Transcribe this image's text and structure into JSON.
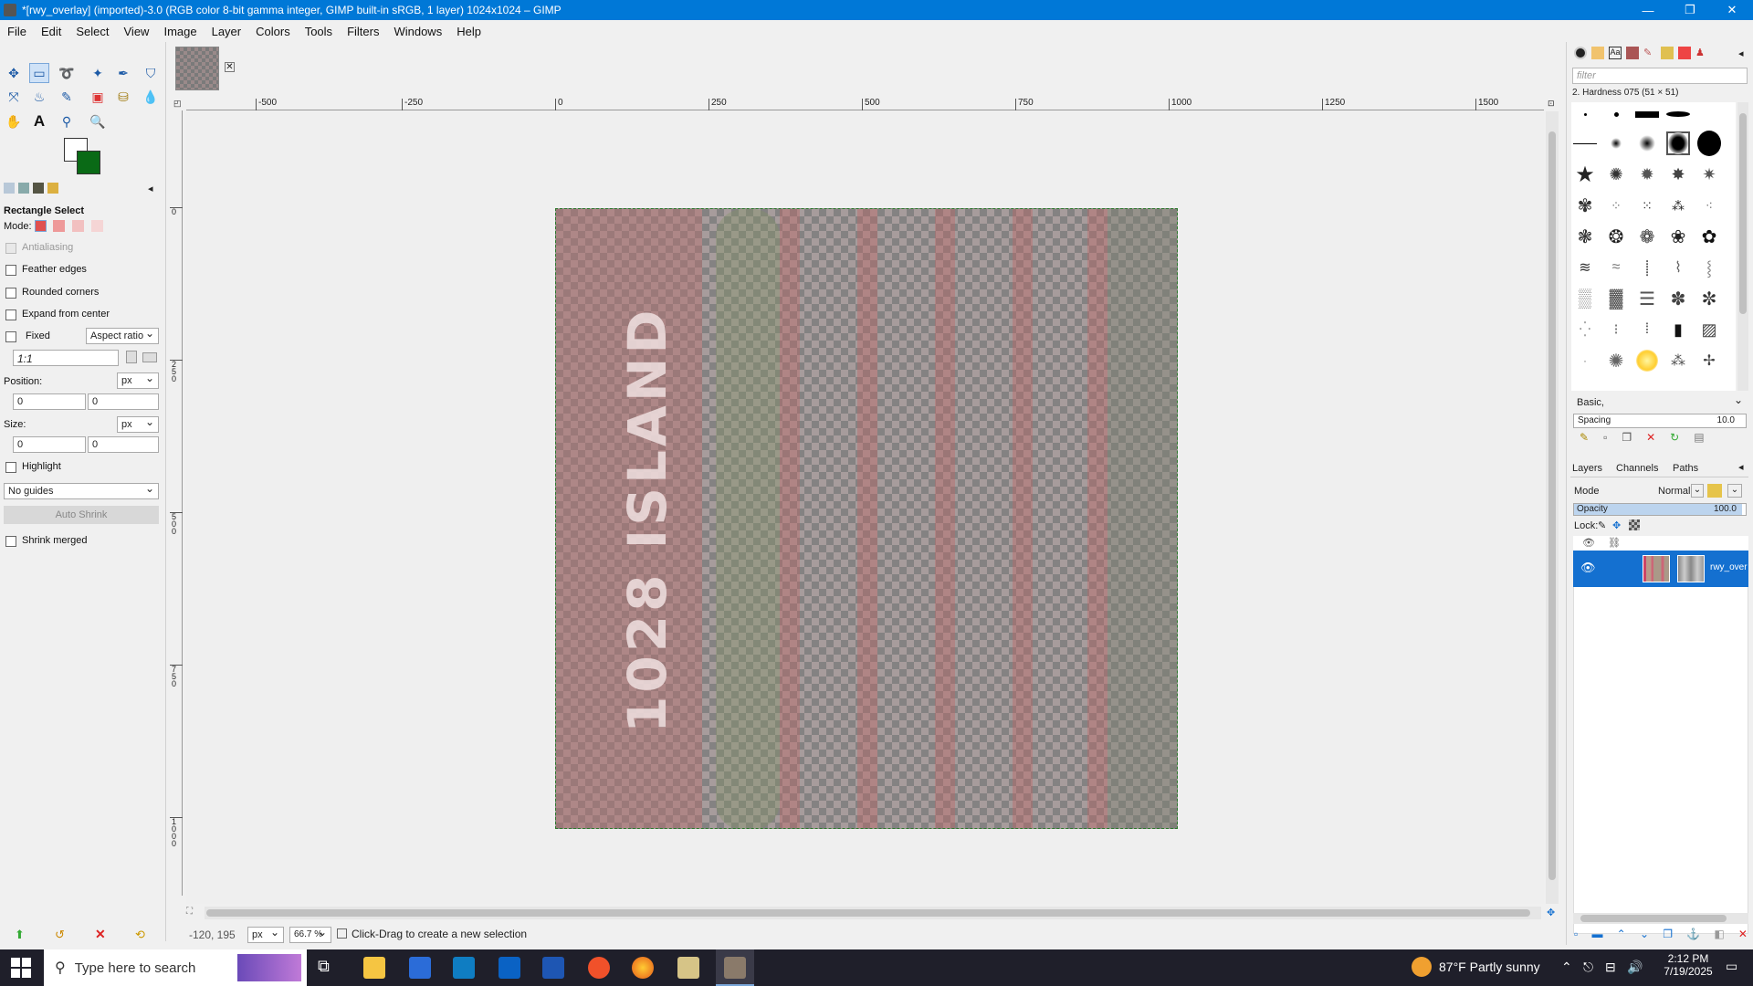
{
  "window": {
    "title": "*[rwy_overlay] (imported)-3.0 (RGB color 8-bit gamma integer, GIMP built-in sRGB, 1 layer) 1024x1024 – GIMP",
    "minimize": "—",
    "maximize": "❐",
    "close": "✕"
  },
  "menu": [
    "File",
    "Edit",
    "Select",
    "View",
    "Image",
    "Layer",
    "Colors",
    "Tools",
    "Filters",
    "Windows",
    "Help"
  ],
  "toolbox": {
    "tabs_close": "⊠",
    "tool_options_title": "Rectangle Select",
    "mode_label": "Mode:",
    "antialiasing": "Antialiasing",
    "feather_edges": "Feather edges",
    "rounded_corners": "Rounded corners",
    "expand_from_center": "Expand from center",
    "fixed_label": "Fixed",
    "fixed_value": "Aspect ratio",
    "ratio_value": "1:1",
    "position_label": "Position:",
    "position_unit": "px",
    "position_x": "0",
    "position_y": "0",
    "size_label": "Size:",
    "size_unit": "px",
    "size_w": "0",
    "size_h": "0",
    "highlight": "Highlight",
    "guides": "No guides",
    "auto_shrink": "Auto Shrink",
    "shrink_merged": "Shrink merged"
  },
  "image_tab": {
    "close": "✕"
  },
  "rulers": {
    "h_labels": [
      "-500",
      "-250",
      "0",
      "250",
      "500",
      "750",
      "1000",
      "1250",
      "1500"
    ],
    "v_labels": [
      "0",
      "250",
      "500",
      "750",
      "1000"
    ]
  },
  "image": {
    "painted_text": "1028 ISLAND"
  },
  "statusbar": {
    "coords": "-120, 195",
    "unit": "px",
    "zoom": "66.7 %",
    "message": "Click-Drag to create a new selection"
  },
  "brushes": {
    "filter_placeholder": "filter",
    "brush_name": "2. Hardness 075 (51 × 51)",
    "preset": "Basic,",
    "spacing_label": "Spacing",
    "spacing_value": "10.0"
  },
  "layers_panel": {
    "tab_layers": "Layers",
    "tab_channels": "Channels",
    "tab_paths": "Paths",
    "mode_label": "Mode",
    "mode_value": "Normal",
    "opacity_label": "Opacity",
    "opacity_value": "100.0",
    "lock_label": "Lock:",
    "layer_name": "rwy_over"
  },
  "taskbar": {
    "search_placeholder": "Type here to search",
    "weather": "87°F  Partly sunny",
    "time": "2:12 PM",
    "date": "7/19/2025"
  },
  "colors": {
    "titlebar": "#0078d7",
    "selection": "#1470d0",
    "background_color": "#0a6a16"
  }
}
